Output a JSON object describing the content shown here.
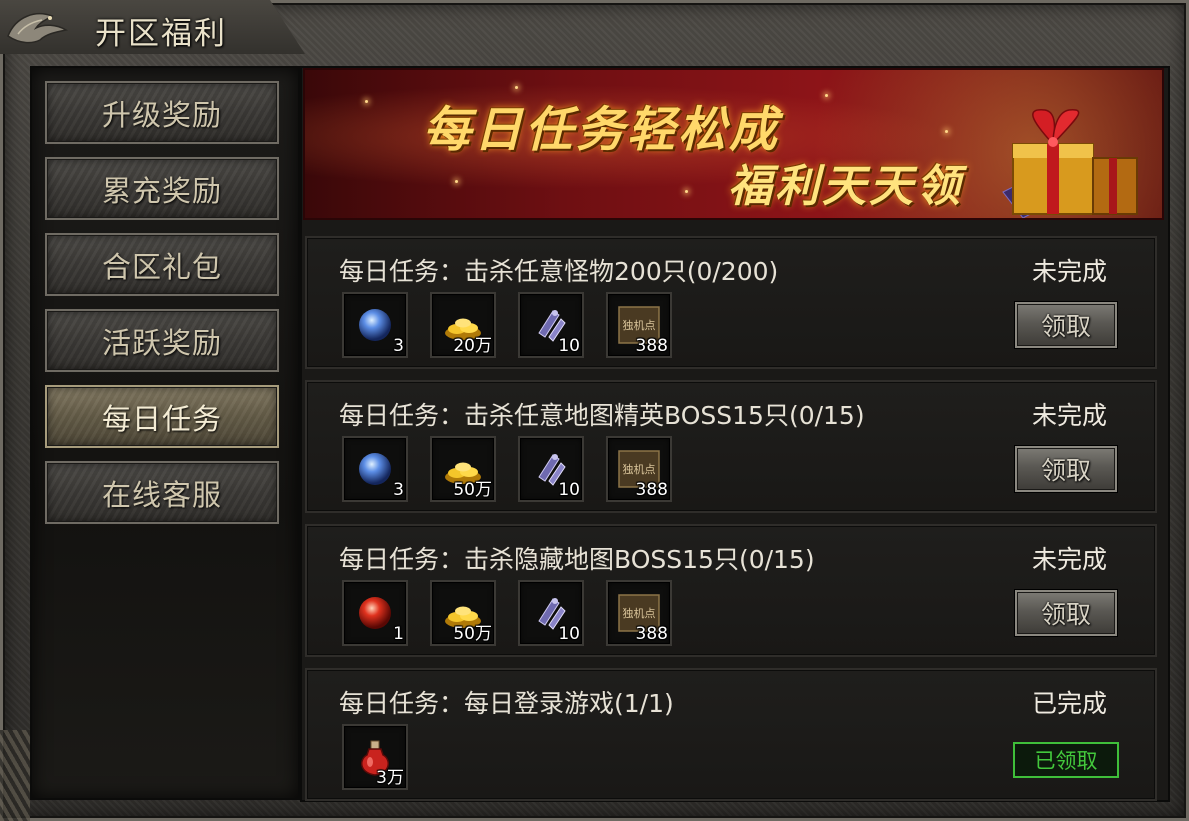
{
  "window": {
    "title": "开区福利"
  },
  "sidebar": {
    "items": [
      {
        "label": "升级奖励",
        "active": false
      },
      {
        "label": "累充奖励",
        "active": false
      },
      {
        "label": "合区礼包",
        "active": false
      },
      {
        "label": "活跃奖励",
        "active": false
      },
      {
        "label": "每日任务",
        "active": true
      },
      {
        "label": "在线客服",
        "active": false
      }
    ]
  },
  "banner": {
    "line1": "每日任务轻松成",
    "line2": "福利天天领"
  },
  "tasks": [
    {
      "title": "每日任务：击杀任意怪物200只(0/200)",
      "status": "未完成",
      "action": "领取",
      "rewards": [
        {
          "icon": "blue-orb-icon",
          "count": "3"
        },
        {
          "icon": "gold-pile-icon",
          "count": "20万"
        },
        {
          "icon": "scroll-icon",
          "count": "10"
        },
        {
          "icon": "points-card-icon",
          "count": "388",
          "icon_text": "独机点"
        }
      ]
    },
    {
      "title": "每日任务：击杀任意地图精英BOSS15只(0/15)",
      "status": "未完成",
      "action": "领取",
      "rewards": [
        {
          "icon": "blue-orb-icon",
          "count": "3"
        },
        {
          "icon": "gold-pile-icon",
          "count": "50万"
        },
        {
          "icon": "scroll-icon",
          "count": "10"
        },
        {
          "icon": "points-card-icon",
          "count": "388",
          "icon_text": "独机点"
        }
      ]
    },
    {
      "title": "每日任务：击杀隐藏地图BOSS15只(0/15)",
      "status": "未完成",
      "action": "领取",
      "rewards": [
        {
          "icon": "red-orb-icon",
          "count": "1"
        },
        {
          "icon": "gold-pile-icon",
          "count": "50万"
        },
        {
          "icon": "scroll-icon",
          "count": "10"
        },
        {
          "icon": "points-card-icon",
          "count": "388",
          "icon_text": "独机点"
        }
      ]
    },
    {
      "title": "每日任务：每日登录游戏(1/1)",
      "status": "已完成",
      "action": "已领取",
      "rewards": [
        {
          "icon": "red-potion-icon",
          "count": "3万"
        }
      ]
    }
  ],
  "colors": {
    "claimed_green": "#43c83c",
    "banner_red": "#8d1418",
    "banner_text_gold": "#ffd86a"
  }
}
